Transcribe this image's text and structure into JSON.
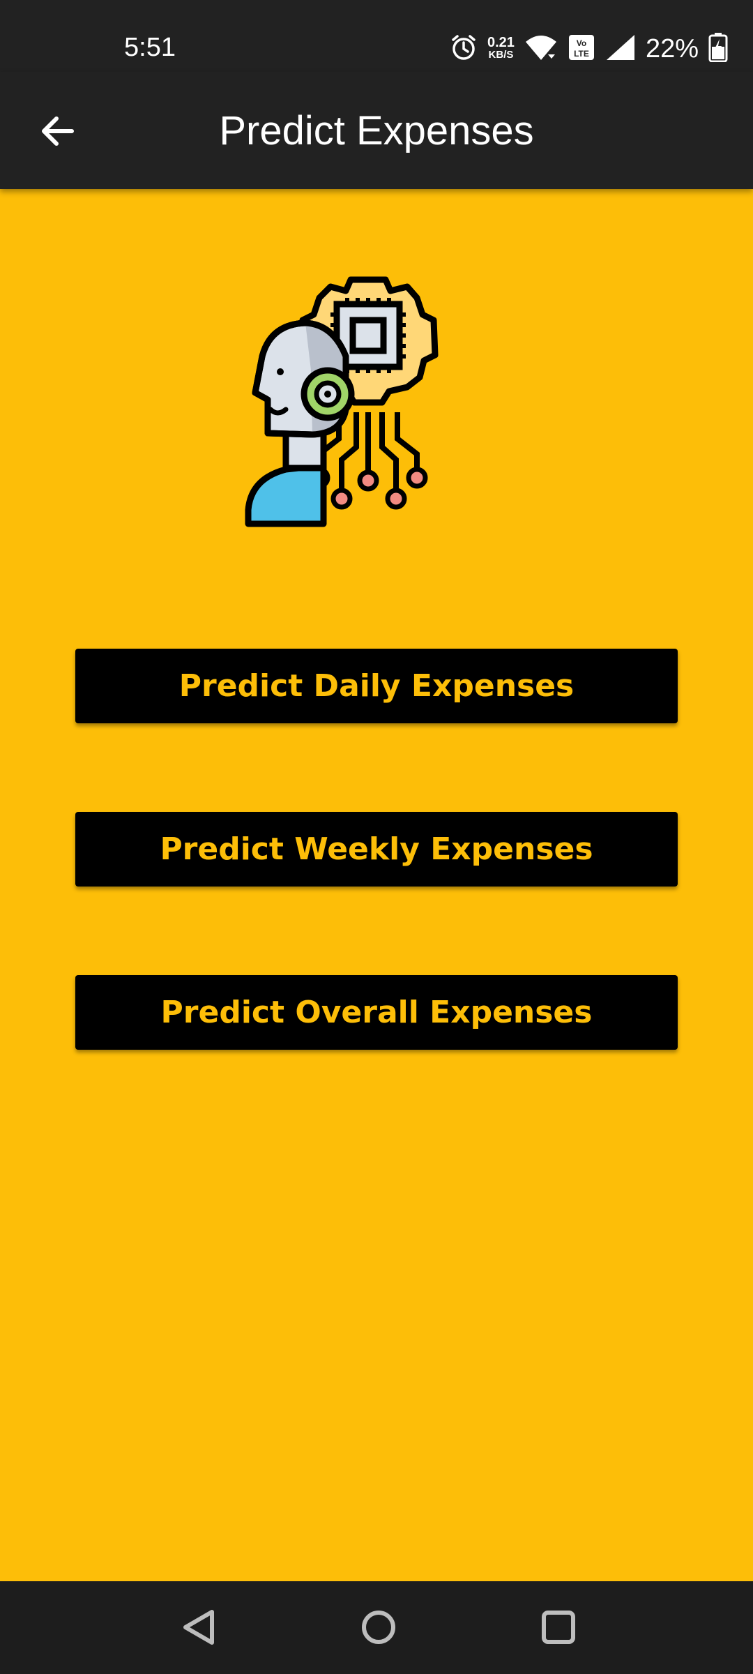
{
  "status_bar": {
    "time": "5:51",
    "net_speed_value": "0.21",
    "net_speed_unit": "KB/S",
    "battery_percent": "22%",
    "icons": [
      "alarm-icon",
      "wifi-icon",
      "volte-icon",
      "signal-icon",
      "battery-charging-icon"
    ]
  },
  "app_bar": {
    "title": "Predict Expenses",
    "back_icon": "arrow-left-icon"
  },
  "hero": {
    "icon": "ai-robot-gear-icon"
  },
  "buttons": [
    {
      "label": "Predict Daily Expenses"
    },
    {
      "label": "Predict Weekly Expenses"
    },
    {
      "label": "Predict Overall Expenses"
    }
  ],
  "nav_bar": {
    "icons": [
      "nav-back-icon",
      "nav-home-icon",
      "nav-recents-icon"
    ]
  },
  "colors": {
    "accent": "#fdbe08",
    "app_bar": "#222222",
    "button_bg": "#000000",
    "nav_bar": "#1d1d1d"
  }
}
